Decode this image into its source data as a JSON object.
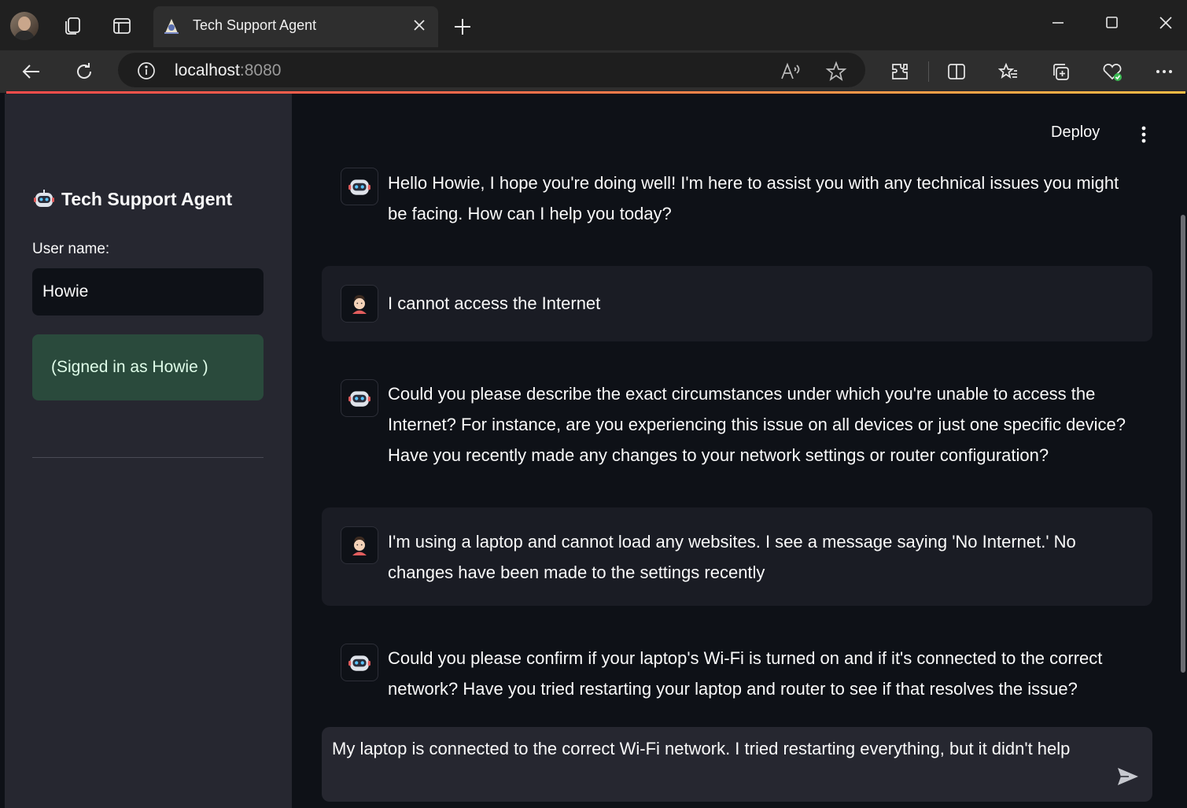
{
  "browser": {
    "tab_title": "Tech Support Agent",
    "url_host": "localhost",
    "url_port": ":8080"
  },
  "sidebar": {
    "title": "Tech Support Agent",
    "username_label": "User name:",
    "username_value": "Howie",
    "signed_in_text": "(Signed in as Howie )"
  },
  "header": {
    "deploy_label": "Deploy"
  },
  "messages": [
    {
      "role": "assistant",
      "text": "Hello Howie, I hope you're doing well! I'm here to assist you with any technical issues you might be facing. How can I help you today?"
    },
    {
      "role": "user",
      "text": "I cannot access the Internet"
    },
    {
      "role": "assistant",
      "text": "Could you please describe the exact circumstances under which you're unable to access the Internet? For instance, are you experiencing this issue on all devices or just one specific device? Have you recently made any changes to your network settings or router configuration?"
    },
    {
      "role": "user",
      "text": "I'm using a laptop and cannot load any websites. I see a message saying 'No Internet.' No changes have been made to the settings recently"
    },
    {
      "role": "assistant",
      "text": "Could you please confirm if your laptop's Wi-Fi is turned on and if it's connected to the correct network? Have you tried restarting your laptop and router to see if that resolves the issue?"
    }
  ],
  "composer": {
    "value": "My laptop is connected to the correct Wi-Fi network. I tried restarting everything, but it didn't help"
  },
  "colors": {
    "accent": "#ff4b4b",
    "sidebar_bg": "#262730",
    "main_bg": "#0e1117",
    "success_bg": "#2e4a3a"
  }
}
